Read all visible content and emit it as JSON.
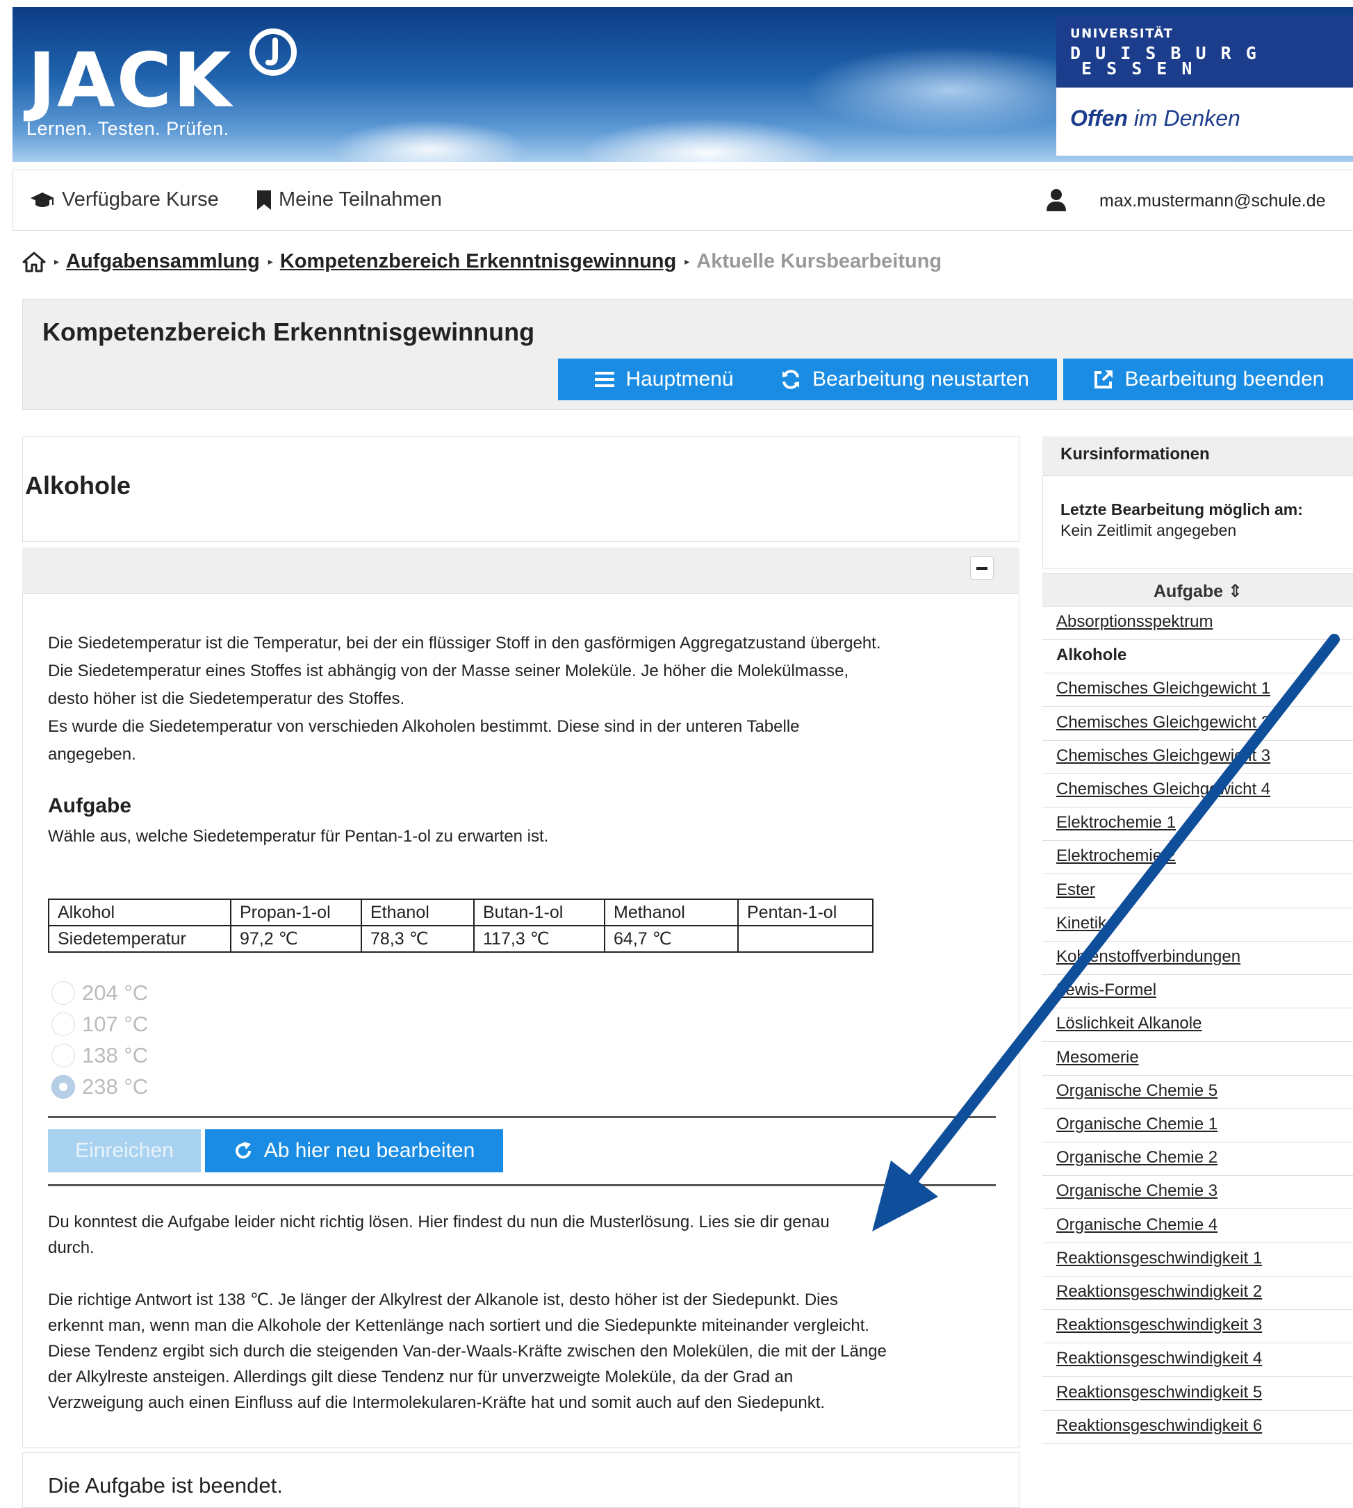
{
  "header": {
    "logo": "JACK",
    "tagline": "Lernen. Testen. Prüfen.",
    "university": {
      "line1": "UNIVERSITÄT",
      "line2": "D U I S B U R G",
      "line3": "E S S E N",
      "slogan_bold": "Offen",
      "slogan_rest": " im Denken"
    }
  },
  "nav": {
    "available_courses": "Verfügbare Kurse",
    "my_participations": "Meine Teilnahmen",
    "user_email": "max.mustermann@schule.de"
  },
  "breadcrumb": {
    "items": [
      "Aufgabensammlung",
      "Kompetenzbereich Erkenntnisgewinnung"
    ],
    "current": "Aktuelle Kursbearbeitung"
  },
  "course": {
    "title": "Kompetenzbereich Erkenntnisgewinnung",
    "main_menu": "Hauptmenü",
    "restart": "Bearbeitung neustarten",
    "finish": "Bearbeitung beenden"
  },
  "task": {
    "title": "Alkohole",
    "intro_lines": [
      "Die Siedetemperatur ist die Temperatur, bei der ein flüssiger Stoff in den gasförmigen Aggregatzustand übergeht.",
      "Die Siedetemperatur eines Stoffes ist abhängig von der Masse seiner Moleküle. Je höher die Molekülmasse,",
      "desto höher ist die Siedetemperatur des Stoffes.",
      "Es wurde die Siedetemperatur von verschieden Alkoholen bestimmt. Diese sind in der unteren Tabelle",
      "angegeben."
    ],
    "aufgabe_heading": "Aufgabe",
    "question": "Wähle aus, welche Siedetemperatur für Pentan-1-ol zu erwarten ist.",
    "table": {
      "header": [
        "Alkohol",
        "Propan-1-ol",
        "Ethanol",
        "Butan-1-ol",
        "Methanol",
        "Pentan-1-ol"
      ],
      "row": [
        "Siedetemperatur",
        "97,2 ℃",
        "78,3 ℃",
        "117,3 ℃",
        "64,7 ℃",
        ""
      ]
    },
    "options": [
      "204 °C",
      "107 °C",
      "138 °C",
      "238 °C"
    ],
    "selected_option": "238 °C",
    "submit": "Einreichen",
    "redo": "Ab hier neu bearbeiten",
    "feedback_lines": [
      "Du konntest die Aufgabe leider nicht richtig lösen. Hier findest du nun die Musterlösung. Lies sie dir genau",
      "durch."
    ],
    "solution_lines": [
      "Die richtige Antwort ist 138 ℃. Je länger der Alkylrest der Alkanole ist, desto höher ist der Siedepunkt. Dies",
      "erkennt man, wenn man die Alkohole der Kettenlänge nach sortiert und die Siedepunkte miteinander vergleicht.",
      "Diese Tendenz ergibt sich durch die steigenden Van-der-Waals-Kräfte zwischen den Molekülen, die mit der Länge",
      "der Alkylreste ansteigen. Allerdings gilt diese Tendenz nur für unverzweigte Moleküle, da der Grad an",
      "Verzweigung auch einen Einfluss auf die Intermolekularen-Kräfte hat und somit auch auf den Siedepunkt."
    ],
    "ended": "Die Aufgabe ist beendet."
  },
  "sidebar": {
    "info_title": "Kursinformationen",
    "last_edit_label": "Letzte Bearbeitung möglich am:",
    "last_edit_value": "Kein Zeitlimit angegeben",
    "list_title": "Aufgabe ⇕",
    "items": [
      "Absorptionsspektrum",
      "Alkohole",
      "Chemisches Gleichgewicht 1",
      "Chemisches Gleichgewicht 2",
      "Chemisches Gleichgewicht 3",
      "Chemisches Gleichgewicht 4",
      "Elektrochemie 1",
      "Elektrochemie 2",
      "Ester",
      "Kinetik",
      "Kohlenstoffverbindungen",
      "Lewis-Formel",
      "Löslichkeit Alkanole",
      "Mesomerie",
      "Organische Chemie 5",
      "Organische Chemie 1",
      "Organische Chemie 2",
      "Organische Chemie 3",
      "Organische Chemie 4",
      "Reaktionsgeschwindigkeit 1",
      "Reaktionsgeschwindigkeit 2",
      "Reaktionsgeschwindigkeit 3",
      "Reaktionsgeschwindigkeit 4",
      "Reaktionsgeschwindigkeit 5",
      "Reaktionsgeschwindigkeit 6"
    ],
    "active_item": "Alkohole"
  },
  "colors": {
    "brand_blue": "#1b3d8c",
    "button_blue": "#1a8ce3",
    "arrow_blue": "#0f4e9a"
  }
}
